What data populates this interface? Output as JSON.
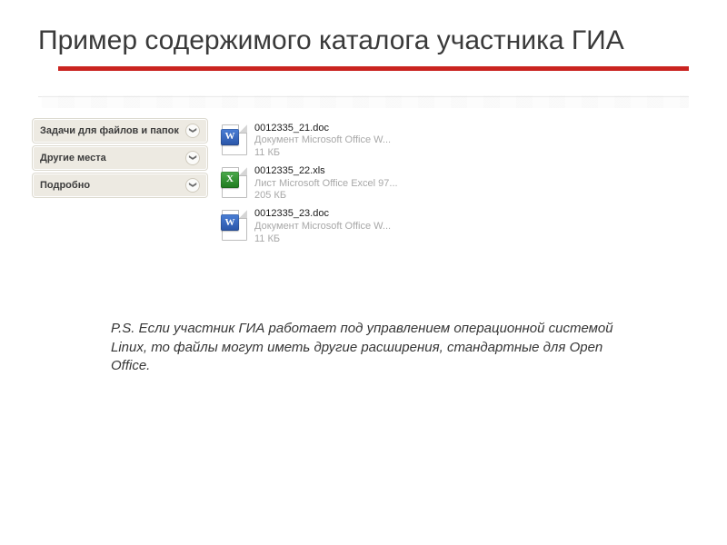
{
  "title": "Пример содержимого каталога участника ГИА",
  "side_panels": [
    {
      "label": "Задачи для файлов и папок"
    },
    {
      "label": "Другие места"
    },
    {
      "label": "Подробно"
    }
  ],
  "files": [
    {
      "name": "0012335_21.doc",
      "type": "Документ Microsoft Office W...",
      "size": "11 КБ",
      "kind": "word",
      "glyph": "W"
    },
    {
      "name": "0012335_22.xls",
      "type": "Лист Microsoft Office Excel 97...",
      "size": "205 КБ",
      "kind": "excel",
      "glyph": "X"
    },
    {
      "name": "0012335_23.doc",
      "type": "Документ Microsoft Office W...",
      "size": "11 КБ",
      "kind": "word",
      "glyph": "W"
    }
  ],
  "footnote": "P.S. Если участник ГИА работает под управлением операционной системой Linux, то файлы могут иметь другие расширения, стандартные для Open Office.",
  "chevron_glyph": "❯"
}
